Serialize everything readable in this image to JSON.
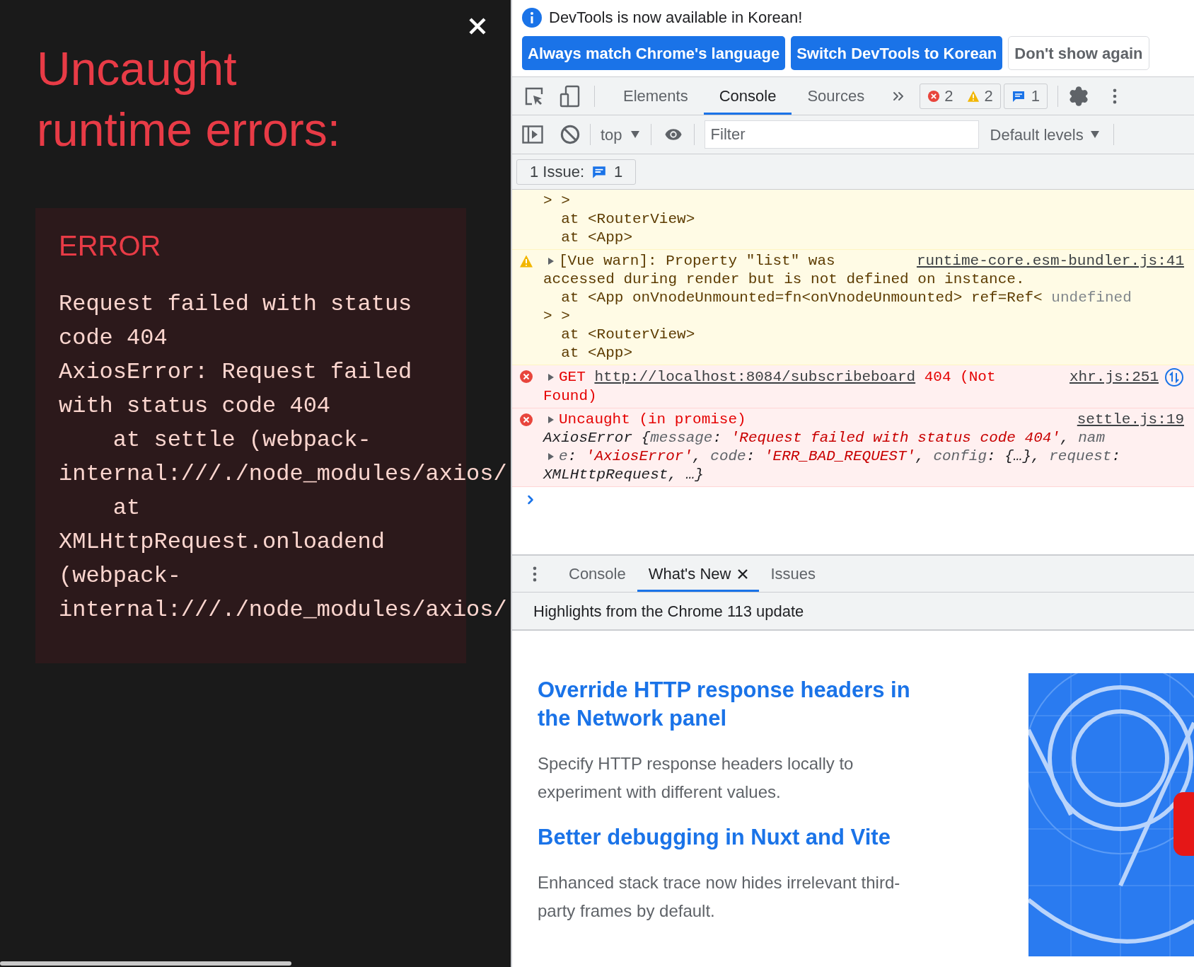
{
  "overlay": {
    "title_lines": [
      "Uncaught",
      "runtime errors:"
    ],
    "error": {
      "label": "ERROR",
      "lines": [
        "Request failed with status",
        "code 404",
        "AxiosError: Request failed",
        "with status code 404",
        "    at settle (webpack-",
        "internal:///./node_modules/axios/",
        "    at",
        "XMLHttpRequest.onloadend",
        "(webpack-",
        "internal:///./node_modules/axios/"
      ]
    }
  },
  "banner": {
    "message": "DevTools is now available in Korean!",
    "buttons": [
      {
        "label": "Always match Chrome's language",
        "kind": "primary"
      },
      {
        "label": "Switch DevTools to Korean",
        "kind": "primary"
      },
      {
        "label": "Don't show again",
        "kind": "secondary"
      }
    ]
  },
  "tabs": [
    {
      "label": "Elements",
      "selected": false
    },
    {
      "label": "Console",
      "selected": true
    },
    {
      "label": "Sources",
      "selected": false
    }
  ],
  "counters": {
    "errors": "2",
    "warnings": "2",
    "issues": "1"
  },
  "console_toolbar": {
    "context": "top",
    "filter": {
      "placeholder": "Filter"
    },
    "levels": "Default levels"
  },
  "issues_bar": {
    "label": "1 Issue:",
    "count": "1"
  },
  "messages": [
    {
      "kind": "warning",
      "lines": [
        {
          "segments": [
            {
              "text": "> >",
              "kind": "plain"
            }
          ]
        },
        {
          "segments": [
            {
              "text": "  at <RouterView>",
              "kind": "plain"
            }
          ]
        },
        {
          "segments": [
            {
              "text": "  at <App>",
              "kind": "plain"
            }
          ]
        }
      ]
    },
    {
      "kind": "warning",
      "source": "runtime-core.esm-bundler.js:41",
      "network": false,
      "lines": [
        {
          "toggle": true,
          "segments": [
            {
              "text": "[Vue warn]: Property \"list\" was",
              "kind": "plain"
            }
          ]
        },
        {
          "segments": [
            {
              "text": "accessed during render but is not defined on instance.",
              "kind": "plain"
            }
          ]
        },
        {
          "segments": [
            {
              "text": "  at <App onVnodeUnmounted=fn<onVnodeUnmounted> ref=Ref< ",
              "kind": "plain"
            },
            {
              "text": "undefined",
              "kind": "dim"
            }
          ]
        },
        {
          "segments": [
            {
              "text": "> >",
              "kind": "plain"
            }
          ]
        },
        {
          "segments": [
            {
              "text": "  at <RouterView>",
              "kind": "plain"
            }
          ]
        },
        {
          "segments": [
            {
              "text": "  at <App>",
              "kind": "plain"
            }
          ]
        }
      ]
    },
    {
      "kind": "error",
      "source": "xhr.js:251",
      "network": true,
      "lines": [
        {
          "toggle": true,
          "segments": [
            {
              "text": "GET ",
              "kind": "plain"
            },
            {
              "text": "http://localhost:8084/subscribeboard",
              "kind": "link"
            },
            {
              "text": " 404 (Not",
              "kind": "plain"
            }
          ]
        },
        {
          "segments": [
            {
              "text": "Found)",
              "kind": "plain"
            }
          ]
        }
      ]
    },
    {
      "kind": "error",
      "source": "settle.js:19",
      "network": false,
      "lines": [
        {
          "toggle": true,
          "segments": [
            {
              "text": "Uncaught (in promise)",
              "kind": "plain"
            }
          ]
        },
        {
          "segments": [
            {
              "text": "AxiosError {",
              "kind": "object"
            },
            {
              "text": "message",
              "kind": "key"
            },
            {
              "text": ": ",
              "kind": "object"
            },
            {
              "text": "'Request failed with status code 404'",
              "kind": "string"
            },
            {
              "text": ", ",
              "kind": "object"
            },
            {
              "text": "nam",
              "kind": "key"
            }
          ]
        },
        {
          "toggle": true,
          "segments": [
            {
              "text": "e",
              "kind": "key"
            },
            {
              "text": ": ",
              "kind": "object"
            },
            {
              "text": "'AxiosError'",
              "kind": "string"
            },
            {
              "text": ", ",
              "kind": "object"
            },
            {
              "text": "code",
              "kind": "key"
            },
            {
              "text": ": ",
              "kind": "object"
            },
            {
              "text": "'ERR_BAD_REQUEST'",
              "kind": "string"
            },
            {
              "text": ", ",
              "kind": "object"
            },
            {
              "text": "config",
              "kind": "key"
            },
            {
              "text": ": {…}, ",
              "kind": "object"
            },
            {
              "text": "request",
              "kind": "key"
            },
            {
              "text": ":",
              "kind": "object"
            }
          ]
        },
        {
          "segments": [
            {
              "text": "XMLHttpRequest, …}",
              "kind": "object"
            }
          ]
        }
      ]
    }
  ],
  "drawer": {
    "tabs": [
      {
        "label": "Console",
        "selected": false,
        "closable": false
      },
      {
        "label": "What's New",
        "selected": true,
        "closable": true
      },
      {
        "label": "Issues",
        "selected": false,
        "closable": false
      }
    ],
    "header": "Highlights from the Chrome 113 update",
    "articles": [
      {
        "title": "Override HTTP response headers in the Network panel",
        "description": "Specify HTTP response headers locally to experiment with different values."
      },
      {
        "title": "Better debugging in Nuxt and Vite",
        "description": "Enhanced stack trace now hides irrelevant third-party frames by default."
      }
    ]
  }
}
